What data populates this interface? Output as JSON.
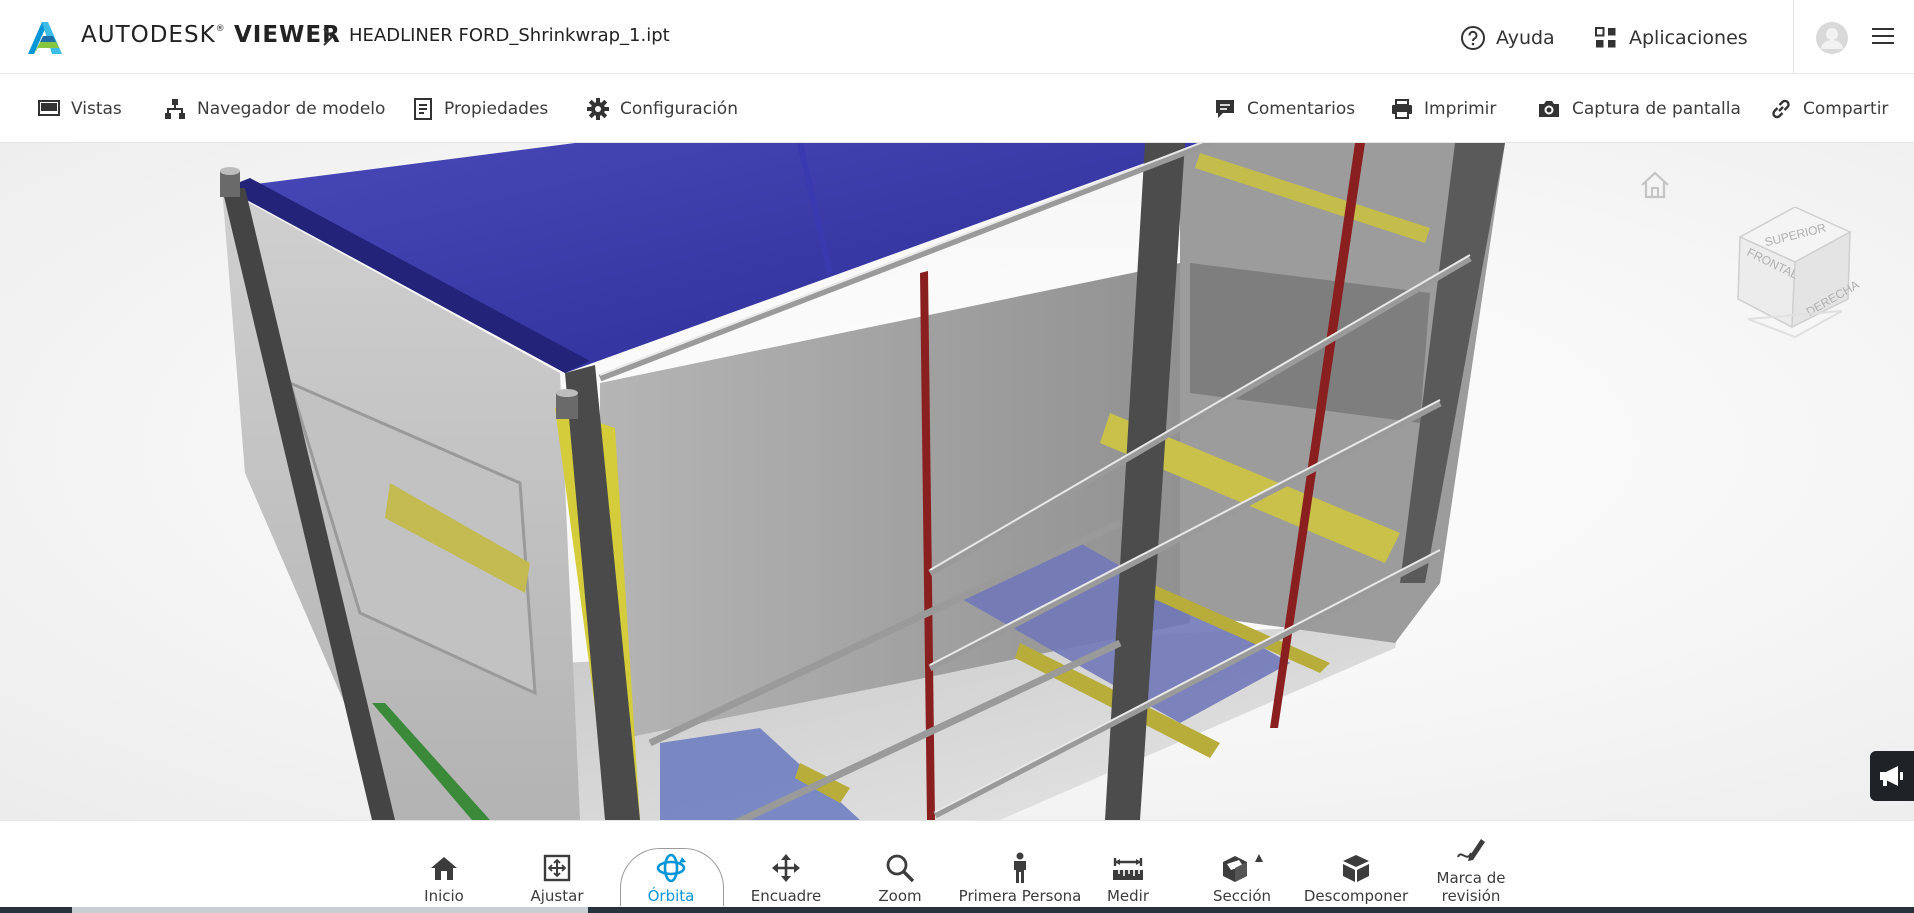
{
  "header": {
    "brand_light": "AUTODESK",
    "brand_reg": "®",
    "brand_bold": "VIEWER",
    "filename": "HEADLINER FORD_Shrinkwrap_1.ipt",
    "help_label": "Ayuda",
    "apps_label": "Aplicaciones",
    "logo_icon": "autodesk-logo-icon",
    "accent_color": "#0696d7"
  },
  "toolbar": {
    "left": [
      {
        "label": "Vistas",
        "icon": "monitor-icon"
      },
      {
        "label": "Navegador de modelo",
        "icon": "model-tree-icon"
      },
      {
        "label": "Propiedades",
        "icon": "document-icon"
      },
      {
        "label": "Configuración",
        "icon": "gear-icon"
      }
    ],
    "right": [
      {
        "label": "Comentarios",
        "icon": "comment-icon"
      },
      {
        "label": "Imprimir",
        "icon": "printer-icon"
      },
      {
        "label": "Captura de pantalla",
        "icon": "camera-icon"
      },
      {
        "label": "Compartir",
        "icon": "link-icon"
      }
    ]
  },
  "viewcube": {
    "top": "SUPERIOR",
    "front": "FRONTAL",
    "right": "DERECHA"
  },
  "bottom_toolbar": {
    "active": "Órbita",
    "tools": [
      {
        "label": "Inicio",
        "icon": "home-icon"
      },
      {
        "label": "Ajustar",
        "icon": "fit-icon"
      },
      {
        "label": "Órbita",
        "icon": "orbit-icon"
      },
      {
        "label": "Encuadre",
        "icon": "pan-icon"
      },
      {
        "label": "Zoom",
        "icon": "zoom-icon"
      },
      {
        "label": "Primera Persona",
        "icon": "person-icon"
      },
      {
        "label": "Medir",
        "icon": "measure-icon"
      },
      {
        "label": "Sección",
        "icon": "section-icon"
      },
      {
        "label": "Descomponer",
        "icon": "explode-icon"
      },
      {
        "label": "Marca de",
        "label2": "revisión",
        "icon": "markup-icon"
      }
    ]
  }
}
